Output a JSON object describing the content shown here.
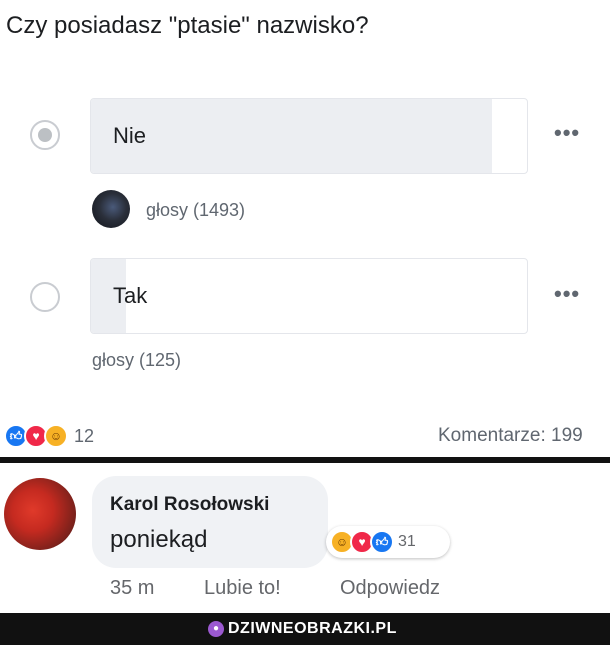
{
  "poll": {
    "question": "Czy posiadasz \"ptasie\" nazwisko?",
    "options": [
      {
        "label": "Nie",
        "votes": "głosy (1493)",
        "selected": true,
        "share": 0.92
      },
      {
        "label": "Tak",
        "votes": "głosy (125)",
        "selected": false,
        "share": 0.08
      }
    ],
    "more_icon": "ellipsis-icon"
  },
  "post_reactions": {
    "icons": [
      "like-icon",
      "love-icon",
      "haha-icon"
    ],
    "count": "12",
    "comments": "Komentarze: 199"
  },
  "comment": {
    "author": "Karol Rosołowski",
    "text": "poniekąd",
    "reaction_icons": [
      "haha-icon",
      "love-icon",
      "like-icon"
    ],
    "reaction_count": "31",
    "time": "35 m",
    "like_action": "Lubie to!",
    "reply_action": "Odpowiedz"
  },
  "footer": {
    "site": "DZIWNEOBRAZKI.PL"
  },
  "colors": {
    "like": "#1877f2",
    "love": "#f02849",
    "haha": "#f7b125",
    "footer_bg": "#111111"
  }
}
